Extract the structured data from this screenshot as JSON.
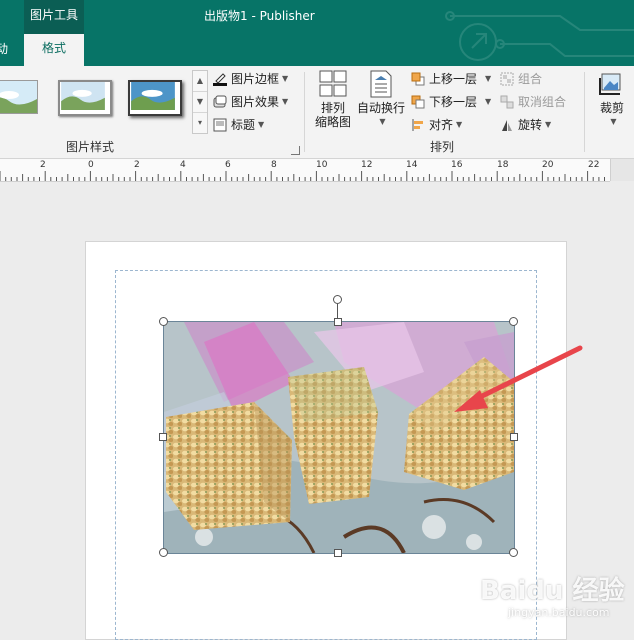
{
  "titlebar": {
    "context_tab": "图片工具",
    "document_title": "出版物1  -  Publisher"
  },
  "tabs": {
    "partial_left": "动",
    "active": "格式"
  },
  "ribbon": {
    "picture_styles": {
      "group_label": "图片样式",
      "border": "图片边框",
      "effects": "图片效果",
      "caption": "标题"
    },
    "arrange": {
      "group_label": "排列",
      "arrange_thumbnails_line1": "排列",
      "arrange_thumbnails_line2": "缩略图",
      "wrap_text": "自动换行",
      "bring_forward": "上移一层",
      "send_backward": "下移一层",
      "align": "对齐",
      "group": "组合",
      "ungroup": "取消组合",
      "rotate": "旋转"
    },
    "crop": "裁剪"
  },
  "ruler": {
    "labels": [
      "2",
      "0",
      "2",
      "4",
      "6",
      "8",
      "10",
      "12",
      "14",
      "16",
      "18",
      "20",
      "22"
    ]
  },
  "watermark": {
    "main": "Baidu 经验",
    "sub": "jingyan.baidu.com"
  },
  "colors": {
    "titlebar": "#077467",
    "accent_text": "#0b6d60",
    "annotation_arrow": "#e8454b"
  }
}
